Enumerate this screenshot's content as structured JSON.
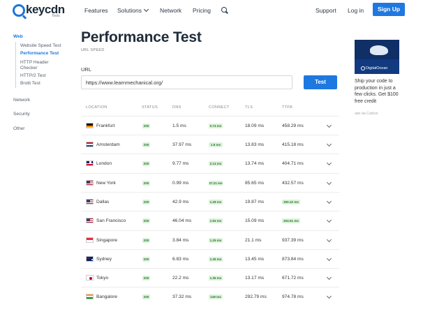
{
  "header": {
    "logo_text": "keycdn",
    "logo_sub": "Tools",
    "nav": {
      "features": "Features",
      "solutions": "Solutions",
      "network": "Network",
      "pricing": "Pricing",
      "support": "Support",
      "login": "Log in"
    },
    "signup_label": "Sign Up"
  },
  "sidebar": {
    "web": "Web",
    "web_items": [
      "Website Speed Test",
      "Performance Test",
      "HTTP Header Checker",
      "HTTP/2 Test",
      "Brotli Test"
    ],
    "active_item": "Performance Test",
    "sections": [
      "Network",
      "Security",
      "Other"
    ]
  },
  "main": {
    "title": "Performance Test",
    "subtitle": "URL SPEED",
    "url_label": "URL",
    "url_value": "https://www.learnmechanical.org/",
    "test_button": "Test"
  },
  "table": {
    "columns": [
      "LOCATION",
      "STATUS",
      "DNS",
      "CONNECT",
      "TLS",
      "TTFB"
    ],
    "rows": [
      {
        "flag": "de",
        "location": "Frankfurt",
        "status": "200",
        "dns": "1.5 ms",
        "connect": "0.74 ms",
        "tls": "18.09 ms",
        "ttfb": "458.29 ms",
        "ttfb_badge": false
      },
      {
        "flag": "nl",
        "location": "Amsterdam",
        "status": "200",
        "dns": "37.97 ms",
        "connect": "1.8 ms",
        "tls": "13.83 ms",
        "ttfb": "415.18 ms",
        "ttfb_badge": false
      },
      {
        "flag": "gb",
        "location": "London",
        "status": "200",
        "dns": "9.77 ms",
        "connect": "2.14 ms",
        "tls": "13.74 ms",
        "ttfb": "404.71 ms",
        "ttfb_badge": false
      },
      {
        "flag": "us",
        "location": "New York",
        "status": "200",
        "dns": "0.99 ms",
        "connect": "37.21 ms",
        "tls": "85.65 ms",
        "ttfb": "432.57 ms",
        "ttfb_badge": false
      },
      {
        "flag": "us",
        "location": "Dallas",
        "status": "200",
        "dns": "42.9 ms",
        "connect": "1.28 ms",
        "tls": "19.87 ms",
        "ttfb": "300.32 ms",
        "ttfb_badge": true
      },
      {
        "flag": "us",
        "location": "San Francisco",
        "status": "200",
        "dns": "46.04 ms",
        "connect": "1.94 ms",
        "tls": "15.09 ms",
        "ttfb": "304.61 ms",
        "ttfb_badge": true
      },
      {
        "flag": "sg",
        "location": "Singapore",
        "status": "200",
        "dns": "3.84 ms",
        "connect": "1.25 ms",
        "tls": "21.1 ms",
        "ttfb": "937.39 ms",
        "ttfb_badge": false
      },
      {
        "flag": "au",
        "location": "Sydney",
        "status": "200",
        "dns": "6.83 ms",
        "connect": "1.35 ms",
        "tls": "13.45 ms",
        "ttfb": "873.84 ms",
        "ttfb_badge": false
      },
      {
        "flag": "jp",
        "location": "Tokyo",
        "status": "200",
        "dns": "22.2 ms",
        "connect": "1.35 ms",
        "tls": "13.17 ms",
        "ttfb": "671.72 ms",
        "ttfb_badge": false
      },
      {
        "flag": "in",
        "location": "Bangalore",
        "status": "200",
        "dns": "37.32 ms",
        "connect": "139 ms",
        "tls": "292.79 ms",
        "ttfb": "974.78 ms",
        "ttfb_badge": false
      }
    ]
  },
  "ad": {
    "brand": "DigitalOcean",
    "copy": "Ship your code to production in just a few clicks. Get $100 free credit",
    "via": "ads via Carbon"
  },
  "colors": {
    "accent": "#1e78e0",
    "badge_bg": "#ddf2dc",
    "badge_text": "#2a7a2a"
  }
}
